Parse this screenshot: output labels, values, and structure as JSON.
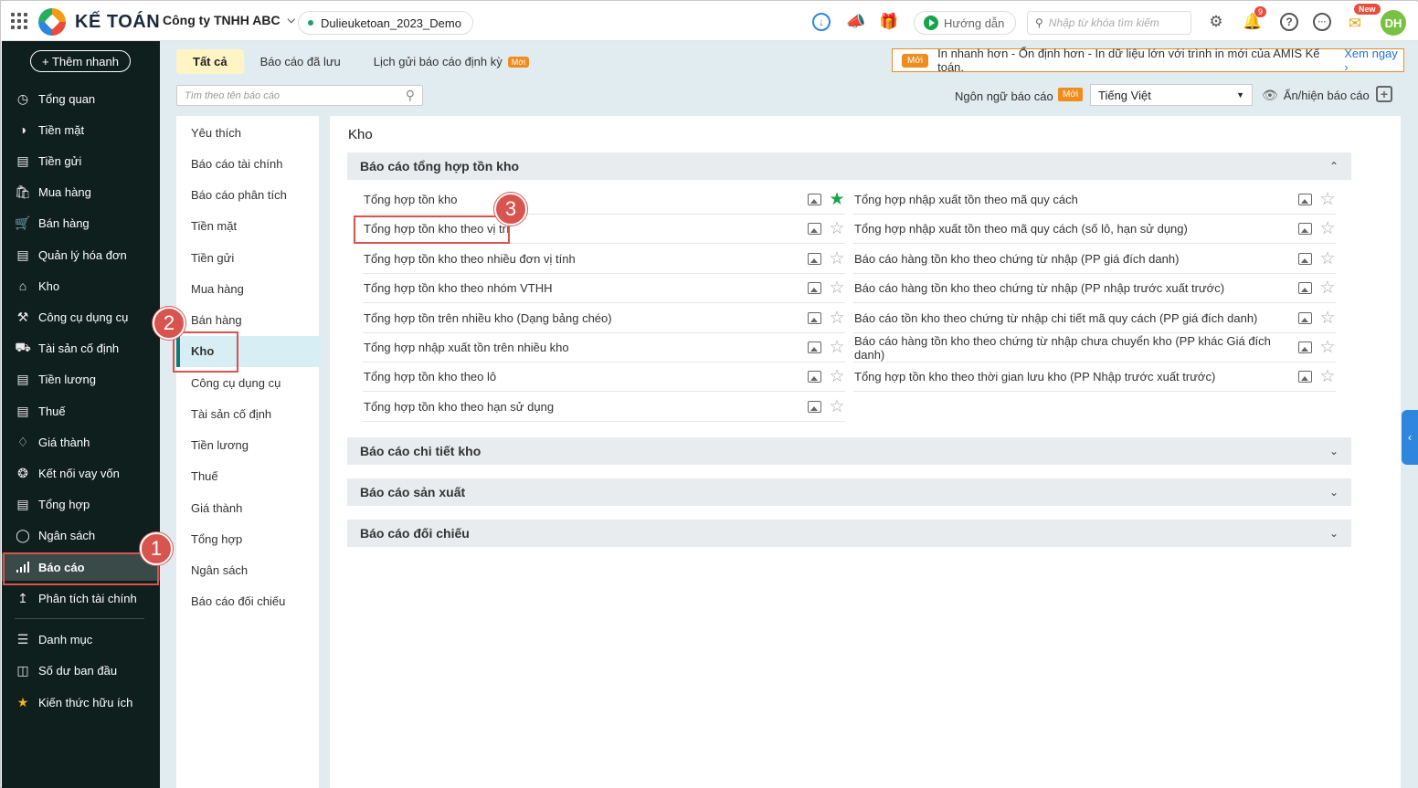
{
  "topbar": {
    "app_name": "KẾ TOÁN",
    "company": "Công ty TNHH ABC",
    "database": "Dulieuketoan_2023_Demo",
    "guide_label": "Hướng dẫn",
    "search_placeholder": "Nhập từ khóa tìm kiếm",
    "notification_count": "9",
    "new_badge": "New",
    "avatar_initials": "DH"
  },
  "sidebar": {
    "quick_add": "+ Thêm nhanh",
    "items": [
      {
        "label": "Tổng quan",
        "icon": "dashboard-icon"
      },
      {
        "label": "Tiền mặt",
        "icon": "cash-icon"
      },
      {
        "label": "Tiền gửi",
        "icon": "bank-icon"
      },
      {
        "label": "Mua hàng",
        "icon": "shopping-bag-icon"
      },
      {
        "label": "Bán hàng",
        "icon": "cart-icon"
      },
      {
        "label": "Quản lý hóa đơn",
        "icon": "invoice-icon"
      },
      {
        "label": "Kho",
        "icon": "warehouse-icon"
      },
      {
        "label": "Công cụ dụng cụ",
        "icon": "tools-icon"
      },
      {
        "label": "Tài sản cố định",
        "icon": "car-icon"
      },
      {
        "label": "Tiền lương",
        "icon": "payroll-icon"
      },
      {
        "label": "Thuế",
        "icon": "tax-icon"
      },
      {
        "label": "Giá thành",
        "icon": "price-tag-icon"
      },
      {
        "label": "Kết nối vay vốn",
        "icon": "loan-icon"
      },
      {
        "label": "Tổng hợp",
        "icon": "summary-icon"
      },
      {
        "label": "Ngân sách",
        "icon": "budget-icon"
      },
      {
        "label": "Báo cáo",
        "icon": "bar-chart-icon"
      },
      {
        "label": "Phân tích tài chính",
        "icon": "line-chart-icon"
      }
    ],
    "bottom_items": [
      {
        "label": "Danh mục",
        "icon": "list-icon"
      },
      {
        "label": "Số dư ban đầu",
        "icon": "balance-icon"
      },
      {
        "label": "Kiến thức hữu ích",
        "icon": "knowledge-icon"
      }
    ],
    "active_index": 15
  },
  "tabs": [
    {
      "label": "Tất cả",
      "active": true
    },
    {
      "label": "Báo cáo đã lưu",
      "active": false
    },
    {
      "label": "Lịch gửi báo cáo định kỳ",
      "active": false,
      "badge": "Mới"
    }
  ],
  "banner": {
    "badge": "Mới",
    "text": "In nhanh hơn - Ổn định hơn - In dữ liệu lớn với trình in mới của AMIS Kế toán.",
    "link": "Xem ngay"
  },
  "report_search_placeholder": "Tìm theo tên báo cáo",
  "language": {
    "label": "Ngôn ngữ báo cáo",
    "badge": "Mới",
    "value": "Tiếng Việt"
  },
  "toggle_reports_label": "Ẩn/hiện báo cáo",
  "categories": [
    "Yêu thích",
    "Báo cáo tài chính",
    "Báo cáo phân tích",
    "Tiền mặt",
    "Tiền gửi",
    "Mua hàng",
    "Bán hàng",
    "Kho",
    "Công cụ dụng cụ",
    "Tài sản cố định",
    "Tiền lương",
    "Thuế",
    "Giá thành",
    "Tổng hợp",
    "Ngân sách",
    "Báo cáo đối chiếu"
  ],
  "active_category": 7,
  "content": {
    "title": "Kho",
    "groups": [
      {
        "title": "Báo cáo tổng hợp tồn kho",
        "expanded": true,
        "left": [
          {
            "name": "Tổng hợp tồn kho",
            "fav": true
          },
          {
            "name": "Tổng hợp tồn kho theo vị trí",
            "fav": false
          },
          {
            "name": "Tổng hợp tồn kho theo nhiều đơn vị tính",
            "fav": false
          },
          {
            "name": "Tổng hợp tồn kho theo nhóm VTHH",
            "fav": false
          },
          {
            "name": "Tổng hợp tồn trên nhiều kho (Dạng bảng chéo)",
            "fav": false
          },
          {
            "name": "Tổng hợp nhập xuất tồn trên nhiều kho",
            "fav": false
          },
          {
            "name": "Tổng hợp tồn kho theo lô",
            "fav": false
          },
          {
            "name": "Tổng hợp tồn kho theo hạn sử dụng",
            "fav": false
          }
        ],
        "right": [
          {
            "name": "Tổng hợp nhập xuất tồn theo mã quy cách",
            "fav": false
          },
          {
            "name": "Tổng hợp nhập xuất tồn theo mã quy cách (số lô, hạn sử dụng)",
            "fav": false
          },
          {
            "name": "Báo cáo hàng tồn kho theo chứng từ nhập (PP giá đích danh)",
            "fav": false
          },
          {
            "name": "Báo cáo hàng tồn kho theo chứng từ nhập (PP nhập trước xuất trước)",
            "fav": false
          },
          {
            "name": "Báo cáo tồn kho theo chứng từ nhập chi tiết mã quy cách (PP giá đích danh)",
            "fav": false
          },
          {
            "name": "Báo cáo hàng tồn kho theo chứng từ nhập chưa chuyển kho (PP khác Giá đích danh)",
            "fav": false
          },
          {
            "name": "Tổng hợp tồn kho theo thời gian lưu kho (PP Nhập trước xuất trước)",
            "fav": false
          }
        ]
      },
      {
        "title": "Báo cáo chi tiết kho",
        "expanded": false
      },
      {
        "title": "Báo cáo sản xuất",
        "expanded": false
      },
      {
        "title": "Báo cáo đối chiếu",
        "expanded": false
      }
    ]
  },
  "annotations": [
    "1",
    "2",
    "3"
  ]
}
